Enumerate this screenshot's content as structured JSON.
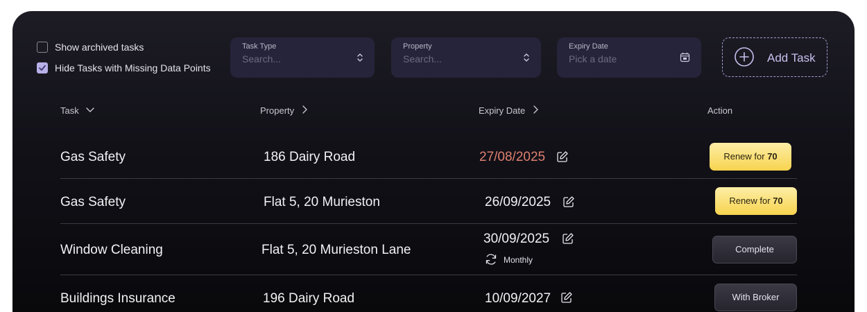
{
  "filters": {
    "show_archived": {
      "label": "Show archived tasks",
      "checked": false
    },
    "hide_missing": {
      "label": "Hide Tasks with Missing Data Points",
      "checked": true
    },
    "task_type": {
      "label": "Task Type",
      "placeholder": "Search..."
    },
    "property": {
      "label": "Property",
      "placeholder": "Search..."
    },
    "expiry": {
      "label": "Expiry Date",
      "placeholder": "Pick a date"
    },
    "add_task_label": "Add Task"
  },
  "columns": {
    "task": "Task",
    "property": "Property",
    "expiry": "Expiry Date",
    "action": "Action"
  },
  "rows": [
    {
      "task": "Gas Safety",
      "property": "186 Dairy Road",
      "expiry": "27/08/2025",
      "action_prefix": "Renew for ",
      "action_value": "70"
    },
    {
      "task": "Gas Safety",
      "property": "Flat 5, 20 Murieston",
      "expiry": "26/09/2025",
      "action_prefix": "Renew for ",
      "action_value": "70"
    },
    {
      "task": "Window Cleaning",
      "property": "Flat 5, 20 Murieston Lane",
      "expiry": "30/09/2025",
      "recurrence": "Monthly",
      "action": "Complete"
    },
    {
      "task": "Buildings Insurance",
      "property": "196 Dairy Road",
      "expiry": "10/09/2027",
      "action": "With Broker"
    }
  ],
  "colors": {
    "expired_date": "#df8070",
    "accent": "#b8b0e6",
    "renew_button": "#f7d34e"
  }
}
